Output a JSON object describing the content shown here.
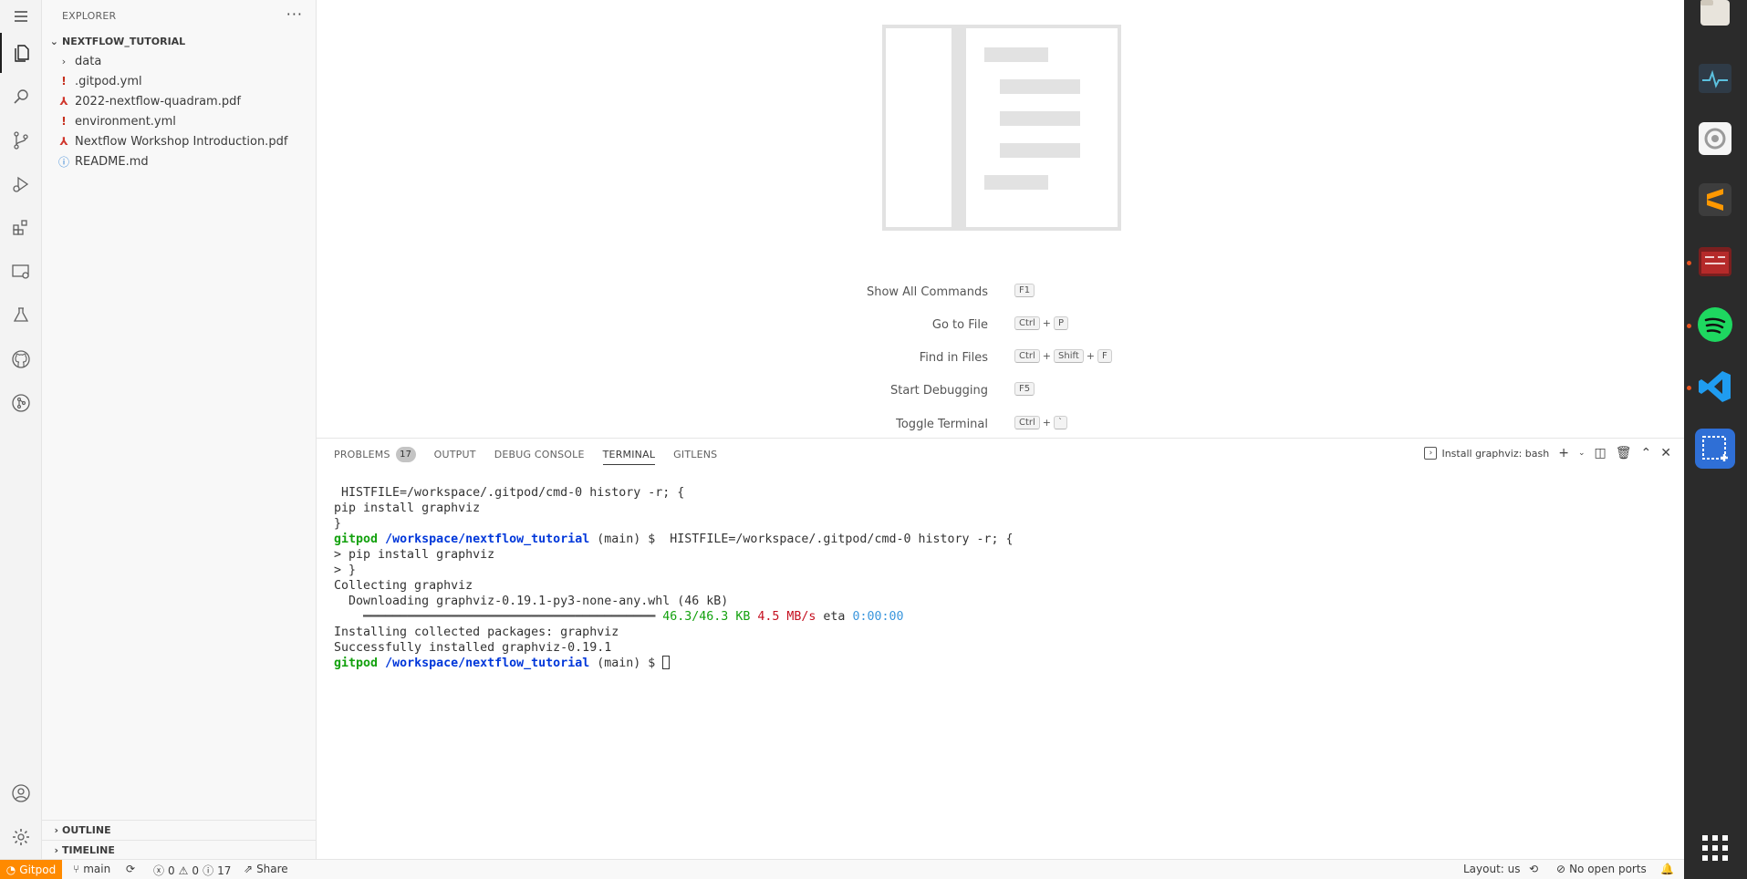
{
  "sidebar": {
    "title": "EXPLORER",
    "more_label": "···",
    "root_folder": "NEXTFLOW_TUTORIAL",
    "items": [
      {
        "label": "data",
        "icon": "chevron-right-icon"
      },
      {
        "label": ".gitpod.yml",
        "icon": "yaml-icon"
      },
      {
        "label": "2022-nextflow-quadram.pdf",
        "icon": "pdf-icon"
      },
      {
        "label": "environment.yml",
        "icon": "yaml-icon"
      },
      {
        "label": "Nextflow Workshop Introduction.pdf",
        "icon": "pdf-icon"
      },
      {
        "label": "README.md",
        "icon": "info-icon"
      }
    ],
    "outline_label": "OUTLINE",
    "timeline_label": "TIMELINE"
  },
  "welcome": {
    "shortcuts": [
      {
        "label": "Show All Commands",
        "keys": [
          "F1"
        ]
      },
      {
        "label": "Go to File",
        "keys": [
          "Ctrl",
          "P"
        ]
      },
      {
        "label": "Find in Files",
        "keys": [
          "Ctrl",
          "Shift",
          "F"
        ]
      },
      {
        "label": "Start Debugging",
        "keys": [
          "F5"
        ]
      },
      {
        "label": "Toggle Terminal",
        "keys": [
          "Ctrl",
          "`"
        ]
      }
    ]
  },
  "panel": {
    "tabs": {
      "problems": "PROBLEMS",
      "problems_count": "17",
      "output": "OUTPUT",
      "debug_console": "DEBUG CONSOLE",
      "terminal": "TERMINAL",
      "gitlens": "GITLENS"
    },
    "terminal_name": "Install graphviz: bash",
    "terminal_lines": {
      "l1": " HISTFILE=/workspace/.gitpod/cmd-0 history -r; {",
      "l2": "pip install graphviz",
      "l3": "}",
      "user": "gitpod",
      "path": "/workspace/nextflow_tutorial",
      "branch_prompt": " (main) $ ",
      "l4_cmd": " HISTFILE=/workspace/.gitpod/cmd-0 history -r; {",
      "l5": "> pip install graphviz",
      "l6": "> }",
      "l7": "Collecting graphviz",
      "l8": "  Downloading graphviz-0.19.1-py3-none-any.whl (46 kB)",
      "progress_size": "46.3/46.3 KB",
      "progress_speed": "4.5 MB/s",
      "progress_eta_label": "eta",
      "progress_eta": "0:00:00",
      "l10": "Installing collected packages: graphviz",
      "l11": "Successfully installed graphviz-0.19.1"
    }
  },
  "statusbar": {
    "remote": "Gitpod",
    "branch": "main",
    "errors": "0",
    "warnings": "0",
    "infos": "17",
    "share": "Share",
    "layout": "Layout: us",
    "ports": "No open ports"
  },
  "colors": {
    "gitpod_orange": "#ff8a00",
    "dock_background": "#2b2b2b",
    "terminal_user_green": "#13a10e",
    "terminal_path_blue": "#0037da"
  }
}
